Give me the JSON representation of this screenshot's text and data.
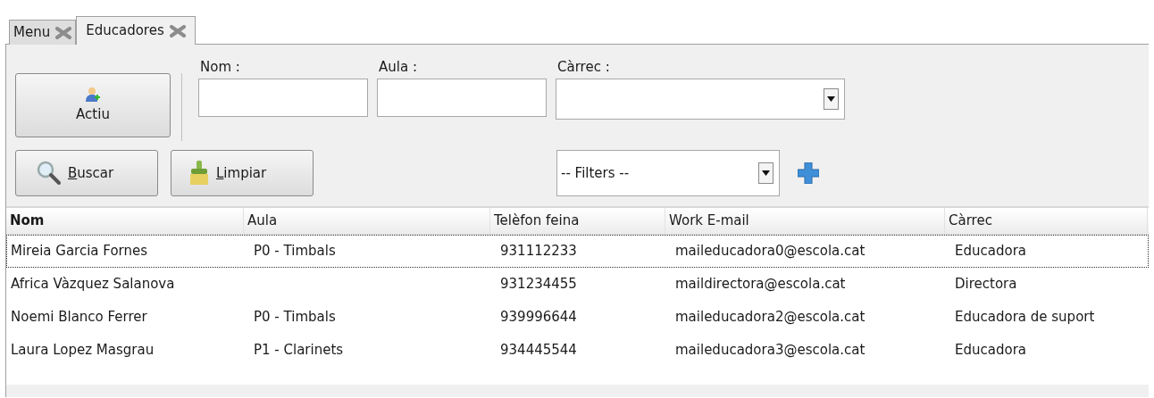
{
  "tabs": [
    {
      "label": "Menu",
      "selected": false
    },
    {
      "label": "Educadores",
      "selected": true
    }
  ],
  "actiu_button": {
    "label": "Actiu"
  },
  "filters": [
    {
      "label": "Nom :",
      "kind": "text"
    },
    {
      "label": "Aula :",
      "kind": "text"
    },
    {
      "label": "Càrrec :",
      "kind": "combo"
    }
  ],
  "buttons": [
    {
      "label": "Buscar",
      "mnemonic_first": true,
      "kind": "search"
    },
    {
      "label": "Limpiar",
      "mnemonic_first": true,
      "kind": "clean"
    }
  ],
  "saved_filters": {
    "value": "-- Filters --"
  },
  "table": {
    "columns": [
      "Nom",
      "Aula",
      "Telèfon feina",
      "Work E-mail",
      "Càrrec"
    ],
    "rows": [
      {
        "selected": true,
        "cells": [
          "Mireia Garcia Fornes",
          "P0 - Timbals",
          "931112233",
          "maileducadora0@escola.cat",
          "Educadora"
        ]
      },
      {
        "selected": false,
        "cells": [
          "Africa Vàzquez Salanova",
          "",
          "931234455",
          "maildirectora@escola.cat",
          "Directora"
        ]
      },
      {
        "selected": false,
        "cells": [
          "Noemi Blanco Ferrer",
          "P0 - Timbals",
          "939996644",
          "maileducadora2@escola.cat",
          "Educadora de suport"
        ]
      },
      {
        "selected": false,
        "cells": [
          "Laura Lopez Masgrau",
          "P1 - Clarinets",
          "934445544",
          "maileducadora3@escola.cat",
          "Educadora"
        ]
      }
    ]
  }
}
